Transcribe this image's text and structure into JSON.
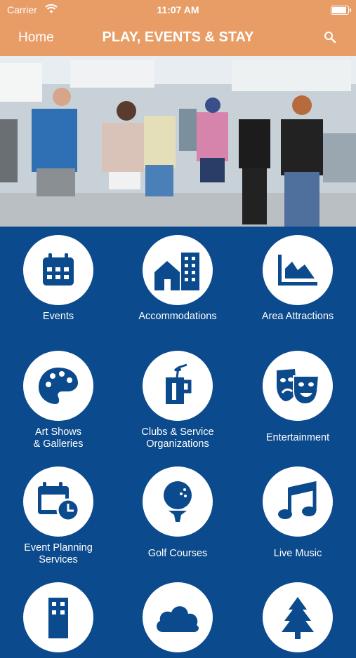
{
  "status_bar": {
    "carrier": "Carrier",
    "time": "11:07 AM"
  },
  "nav": {
    "home_label": "Home",
    "title": "PLAY, EVENTS & STAY",
    "search_icon": "search-icon"
  },
  "colors": {
    "header": "#e79d65",
    "grid_bg": "#0b4a8c",
    "icon_fg": "#0b4a8c",
    "text": "#ffffff"
  },
  "tiles": [
    {
      "label": "Events",
      "icon": "calendar-icon"
    },
    {
      "label": "Accommodations",
      "icon": "buildings-icon"
    },
    {
      "label": "Area Attractions",
      "icon": "mountain-chart-icon"
    },
    {
      "label": "Art Shows\n& Galleries",
      "icon": "palette-icon"
    },
    {
      "label": "Clubs & Service\nOrganizations",
      "icon": "drink-icon"
    },
    {
      "label": "Entertainment",
      "icon": "theater-masks-icon"
    },
    {
      "label": "Event Planning\nServices",
      "icon": "calendar-clock-icon"
    },
    {
      "label": "Golf Courses",
      "icon": "golf-ball-icon"
    },
    {
      "label": "Live Music",
      "icon": "music-note-icon"
    },
    {
      "label": "",
      "icon": "building-icon"
    },
    {
      "label": "",
      "icon": "cloud-icon"
    },
    {
      "label": "",
      "icon": "tree-icon"
    }
  ]
}
